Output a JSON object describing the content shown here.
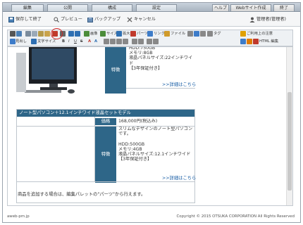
{
  "tabs": {
    "edit": "編集",
    "publish": "公開",
    "structure": "構成",
    "settings": "設定",
    "help": "ヘルプ",
    "create": "Webサイト作成",
    "end": "終了"
  },
  "cmd": {
    "save_exit": "保存して終了",
    "preview": "プレビュー",
    "backup": "バックアップ",
    "cancel": "キャンセル",
    "admin": "管理者(管理者)"
  },
  "toolbar": {
    "image": "画像",
    "size": "サイズ",
    "enlarge": "拡大",
    "parts": "パーツ",
    "link": "リンク",
    "file": "ファイル",
    "tag": "タグ",
    "notes": "ご利用上の注意",
    "heading": "見出し",
    "textsize": "文字サイズ",
    "html_edit": "HTML 編集"
  },
  "product1": {
    "label": "特徴",
    "desc": "HDD:750GB\nメモリ:8GB\n液晶パネルサイズ:22インチワイド\n【3年保証付き】",
    "link": ">>詳細はこちら"
  },
  "product2": {
    "title": "ノート型パソコン＋12.1インチワイド液晶セットモデル",
    "price_label": "価格",
    "price": "168,000円(税込み)",
    "feature_label": "特徴",
    "desc": "スリムなデザインのノート型パソコンです。\n\nHDD:500GB\nメモリ:4GB\n液晶パネルサイズ:12.1インチワイド\n【3年保証付き】",
    "link": ">>詳細はこちら"
  },
  "note": "商品を追加する場合は、編集パレットの\"パーツ\"から行えます。",
  "footer": {
    "left": "aweb-pm.jp",
    "right": "Copyright © 2015 OTSUKA CORPORATION All Rights Reserved"
  }
}
